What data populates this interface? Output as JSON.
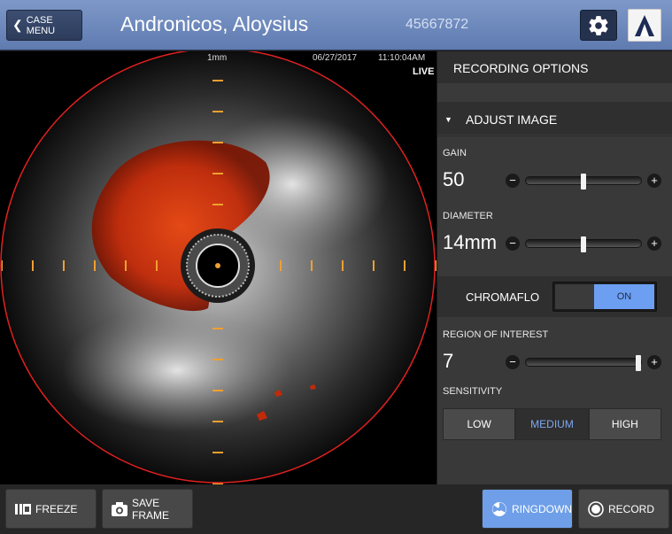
{
  "header": {
    "case_menu_label": "CASE MENU",
    "patient_name": "Andronicos, Aloysius",
    "patient_id": "45667872"
  },
  "viewer": {
    "scale": "1mm",
    "date": "06/27/2017",
    "time": "11:10:04AM",
    "mode": "LIVE"
  },
  "panel": {
    "recording_options": "RECORDING OPTIONS",
    "adjust_image": "ADJUST IMAGE",
    "gain": {
      "label": "GAIN",
      "value": "50",
      "level": 0.5
    },
    "diameter": {
      "label": "DIAMETER",
      "value": "14mm",
      "level": 0.5
    },
    "chromaflo": {
      "label": "CHROMAFLO",
      "state": "ON"
    },
    "region_of_interest": {
      "label": "REGION OF INTEREST",
      "value": "7",
      "level": 1.0
    },
    "sensitivity": {
      "label": "SENSITIVITY",
      "options": [
        "LOW",
        "MEDIUM",
        "HIGH"
      ],
      "selected": "MEDIUM"
    }
  },
  "footer": {
    "freeze": "FREEZE",
    "save_frame": "SAVE FRAME",
    "ringdown": "RINGDOWN",
    "record": "RECORD"
  },
  "colors": {
    "header_blue": "#6f8bc0",
    "accent_blue": "#6c9ff2",
    "flow_red": "#d0300a",
    "marker_orange": "#f0a030",
    "boundary_red": "#e02020"
  },
  "icons": {
    "back": "chevron-left-icon",
    "settings": "gear-icon",
    "logo": "brand-logo",
    "freeze": "pause-frame-icon",
    "save_frame": "camera-icon",
    "ringdown": "ringdown-icon",
    "record": "record-icon"
  }
}
